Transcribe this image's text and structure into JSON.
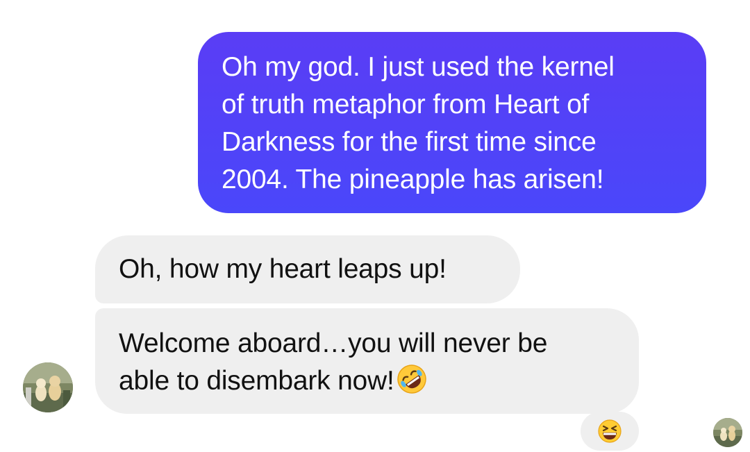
{
  "conversation": {
    "sent_message": {
      "lines": [
        "Oh my god. I just used the kernel",
        "of truth metaphor from Heart of",
        "Darkness for the first time since",
        "2004. The pineapple has arisen!"
      ]
    },
    "received_messages": [
      {
        "lines": [
          "Oh, how my heart leaps up!"
        ]
      },
      {
        "lines": [
          "Welcome aboard…you will never be",
          "able to disembark now!"
        ],
        "trailing_emoji": "rolling-on-floor-laughing-emoji"
      }
    ],
    "reaction": {
      "emoji": "grinning-squinting-face-emoji"
    },
    "colors": {
      "sent_bubble_top": "#5a3df5",
      "sent_bubble_bottom": "#4a47fa",
      "received_bubble": "#efefef",
      "emoji_yellow": "#ffcc33"
    }
  }
}
